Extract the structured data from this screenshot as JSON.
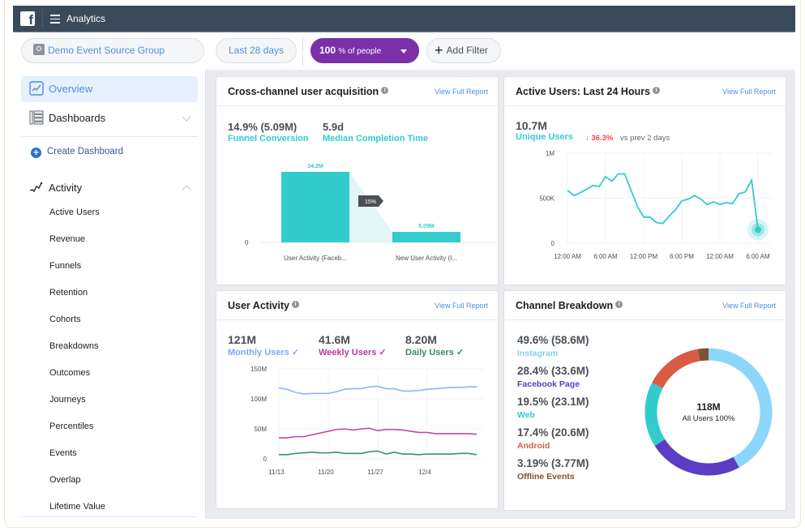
{
  "topbar": {
    "app_title": "Analytics",
    "logo": "f"
  },
  "filters": {
    "source_group": "Demo Event Source Group",
    "date_range": "Last 28 days",
    "people_value": "100",
    "people_suffix": "% of people",
    "add_filter": "Add Filter"
  },
  "sidebar": {
    "overview": "Overview",
    "dashboards": "Dashboards",
    "create_dashboard": "Create Dashboard",
    "activity": "Activity",
    "activity_items": [
      "Active Users",
      "Revenue",
      "Funnels",
      "Retention",
      "Cohorts",
      "Breakdowns",
      "Outcomes",
      "Journeys",
      "Percentiles",
      "Events",
      "Overlap",
      "Lifetime Value"
    ]
  },
  "cards": {
    "view_full_report": "View Full Report",
    "acquisition": {
      "title": "Cross-channel user acquisition",
      "stat1_value": "14.9% (5.09M)",
      "stat1_label": "Funnel Conversion",
      "stat2_value": "5.9d",
      "stat2_label": "Median Completion Time"
    },
    "active_users": {
      "title": "Active Users: Last 24 Hours",
      "value": "10.7M",
      "label": "Unique Users",
      "change": "↓ 36.3%",
      "change_suffix": "vs prev 2 days"
    },
    "user_activity": {
      "title": "User Activity",
      "stats": [
        {
          "value": "121M",
          "label": "Monthly Users ✓",
          "color": "#7fa8f5"
        },
        {
          "value": "41.6M",
          "label": "Weekly Users ✓",
          "color": "#b83c98"
        },
        {
          "value": "8.20M",
          "label": "Daily Users ✓",
          "color": "#3a8a5e"
        }
      ]
    },
    "channel": {
      "title": "Channel Breakdown",
      "center_value": "118M",
      "center_label": "All Users 100%"
    }
  },
  "colors": {
    "teal": "#33cccc",
    "accent_blue": "#4a90e2",
    "purple_pill": "#7b2fa8",
    "decline_red": "#f0484c"
  },
  "chart_data": [
    {
      "type": "bar",
      "title": "Cross-channel user acquisition funnel",
      "categories": [
        "User Activity (Faceb...",
        "New User Activity (I..."
      ],
      "values": [
        34.2,
        5.09
      ],
      "value_labels": [
        "34.2M",
        "5.09M"
      ],
      "conversion_label": "15%",
      "ylabel": "",
      "ytick_labels": [
        "0"
      ],
      "ylim": [
        0,
        40
      ]
    },
    {
      "type": "line",
      "title": "Active Users: Last 24 Hours",
      "x_tick_labels": [
        "12:00 AM",
        "6:00 AM",
        "12:00 PM",
        "6:00 PM",
        "12:00 AM",
        "6:00 AM"
      ],
      "y_tick_labels": [
        "0",
        "500K",
        "1M"
      ],
      "ylim": [
        0,
        1000000
      ],
      "series": [
        {
          "name": "Unique Users",
          "color": "#33cccc",
          "values": [
            590000,
            530000,
            560000,
            600000,
            640000,
            630000,
            740000,
            690000,
            770000,
            770000,
            590000,
            410000,
            290000,
            290000,
            230000,
            220000,
            300000,
            370000,
            470000,
            490000,
            530000,
            490000,
            430000,
            460000,
            430000,
            450000,
            440000,
            550000,
            570000,
            700000,
            150000
          ]
        }
      ]
    },
    {
      "type": "line",
      "title": "User Activity",
      "x_tick_labels": [
        "11/13",
        "11/20",
        "11/27",
        "12/4"
      ],
      "y_tick_labels": [
        "0",
        "50M",
        "100M",
        "150M"
      ],
      "ylim": [
        0,
        150000000
      ],
      "series": [
        {
          "name": "Monthly Users",
          "color": "#8fb3f7",
          "values": [
            118,
            116,
            111,
            108,
            109,
            109,
            109,
            112,
            116,
            117,
            117,
            120,
            121,
            117,
            117,
            113,
            113,
            114,
            116,
            117,
            118,
            119,
            119,
            120,
            120
          ]
        },
        {
          "name": "Weekly Users",
          "color": "#c0489f",
          "values": [
            35,
            35,
            37,
            37,
            40,
            43,
            46,
            49,
            50,
            48,
            50,
            51,
            47,
            49,
            49,
            48,
            46,
            44,
            44,
            42,
            42,
            42,
            42,
            42,
            41
          ]
        },
        {
          "name": "Daily Users",
          "color": "#3f8f66",
          "values": [
            7,
            7,
            9,
            10,
            11,
            10,
            10,
            11,
            9,
            9,
            9,
            12,
            13,
            8,
            11,
            8,
            8,
            7,
            8,
            8,
            8,
            8,
            9,
            9,
            7
          ]
        }
      ]
    },
    {
      "type": "pie",
      "title": "Channel Breakdown",
      "center_text": "118M All Users 100%",
      "slices": [
        {
          "label": "Instagram",
          "percent": 49.6,
          "value": "58.6M",
          "color": "#8dd6fb"
        },
        {
          "label": "Facebook Page",
          "percent": 28.4,
          "value": "33.6M",
          "color": "#5b3cc4"
        },
        {
          "label": "Web",
          "percent": 19.5,
          "value": "23.1M",
          "color": "#33cccc"
        },
        {
          "label": "Android",
          "percent": 17.4,
          "value": "20.6M",
          "color": "#d85c44"
        },
        {
          "label": "Offline Events",
          "percent": 3.19,
          "value": "3.77M",
          "color": "#7d5332"
        }
      ]
    }
  ]
}
